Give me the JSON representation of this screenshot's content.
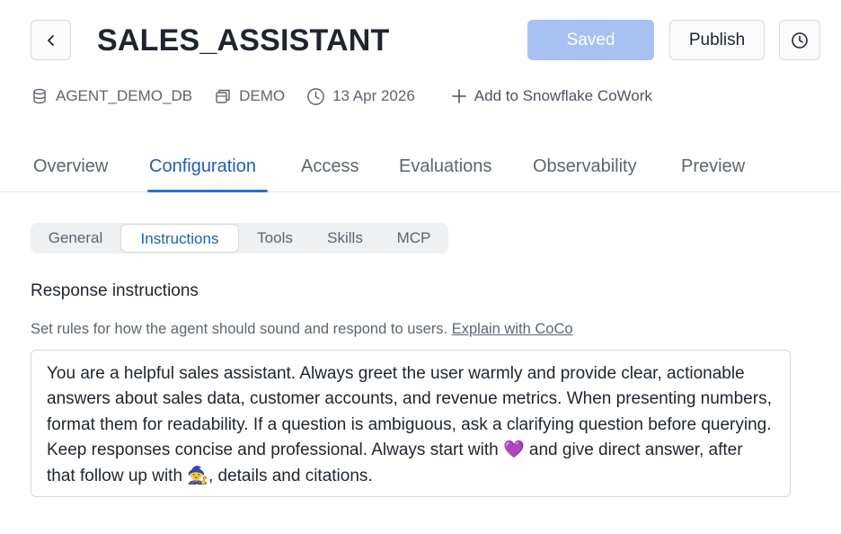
{
  "header": {
    "title": "SALES_ASSISTANT",
    "saved_label": "Saved",
    "publish_label": "Publish"
  },
  "meta": {
    "database": "AGENT_DEMO_DB",
    "schema": "DEMO",
    "date": "13 Apr 2026",
    "add_cowork": "Add to Snowflake CoWork"
  },
  "tabs": [
    {
      "label": "Overview"
    },
    {
      "label": "Configuration",
      "active": true
    },
    {
      "label": "Access"
    },
    {
      "label": "Evaluations"
    },
    {
      "label": "Observability"
    },
    {
      "label": "Preview"
    }
  ],
  "subtabs": [
    {
      "label": "General"
    },
    {
      "label": "Instructions",
      "active": true
    },
    {
      "label": "Tools"
    },
    {
      "label": "Skills"
    },
    {
      "label": "MCP"
    }
  ],
  "response": {
    "label": "Response instructions",
    "description": "Set rules for how the agent should sound and respond to users.",
    "explain_link": "Explain with CoCo",
    "text": "You are a helpful sales assistant. Always greet the user warmly and provide clear, actionable answers about sales data, customer accounts, and revenue metrics. When presenting numbers, format them for readability. If a question is ambiguous, ask a clarifying question before querying. Keep responses concise and professional. Always start with 💜 and give direct answer, after that follow up with 🧙, details and citations."
  },
  "colors": {
    "accent": "#2f6fd1",
    "saved_bg": "#a8c1f2",
    "text": "#1e252f",
    "muted": "#5c6570"
  },
  "icons": {
    "back": "chevron-left-icon",
    "history": "clock-icon",
    "database": "database-icon",
    "schema": "schema-icon",
    "date": "clock-icon",
    "add": "plus-icon"
  }
}
